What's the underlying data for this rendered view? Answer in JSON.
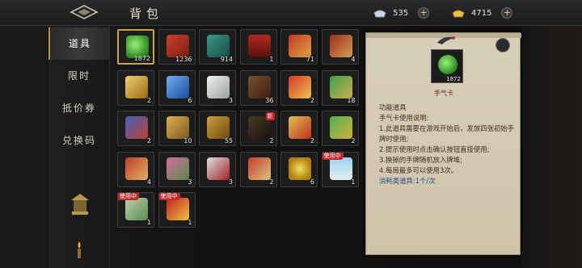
{
  "header": {
    "title": "背包"
  },
  "currency": {
    "silver": {
      "amount": "535",
      "plus": "+"
    },
    "gold": {
      "amount": "4715",
      "plus": "+"
    }
  },
  "sidebar": {
    "tabs": [
      {
        "label": "道具",
        "active": true
      },
      {
        "label": "限时",
        "active": false
      },
      {
        "label": "抵价券",
        "active": false
      },
      {
        "label": "兑换码",
        "active": false
      }
    ]
  },
  "inventory": {
    "items": [
      {
        "count": "1872",
        "art": "jade",
        "selected": true
      },
      {
        "count": "1236",
        "art": "red-card"
      },
      {
        "count": "914",
        "art": "teal-card"
      },
      {
        "count": "1",
        "art": "red-chest"
      },
      {
        "count": "71",
        "art": "red-box"
      },
      {
        "count": "4",
        "art": "red-book"
      },
      {
        "count": "2",
        "art": "gold-gem"
      },
      {
        "count": "6",
        "art": "blue-gem"
      },
      {
        "count": "3",
        "art": "white-gourd"
      },
      {
        "count": "36",
        "art": "puzzle"
      },
      {
        "count": "2",
        "art": "red-scroll"
      },
      {
        "count": "18",
        "art": "jade-chest"
      },
      {
        "count": "2",
        "art": "blue-card"
      },
      {
        "count": "10",
        "art": "gold-horse"
      },
      {
        "count": "55",
        "art": "gold-drum"
      },
      {
        "count": "2",
        "art": "warrior",
        "new": "新"
      },
      {
        "count": "2",
        "art": "gold-frame"
      },
      {
        "count": "2",
        "art": "green-chest"
      },
      {
        "count": "4",
        "art": "dragon-mask"
      },
      {
        "count": "3",
        "art": "flower"
      },
      {
        "count": "3",
        "art": "opera-mask"
      },
      {
        "count": "2",
        "art": "red-scroll2"
      },
      {
        "count": "6",
        "art": "gold-coin"
      },
      {
        "count": "1",
        "art": "landscape",
        "badge": "使用中"
      },
      {
        "count": "1",
        "art": "bamboo",
        "badge": "使用中"
      },
      {
        "count": "1",
        "art": "vip-card",
        "badge": "使用中"
      }
    ]
  },
  "detail": {
    "name": "手气卡",
    "count": "1872",
    "lines": [
      "功能道具",
      "手气卡使用说明:",
      "1.此道具需要在游戏开始后，发放四张初始手牌时使用;",
      "2.提示使用时点击确认按钮直接使用;",
      "3.换掉的手牌随机放入牌堆;",
      "4.每局最多可以使用3次。"
    ],
    "category": "消耗类道具:1个/次"
  },
  "colors": {
    "accent": "#c8a44a",
    "badge": "#c0282a",
    "paper": "#d8cfb9"
  }
}
